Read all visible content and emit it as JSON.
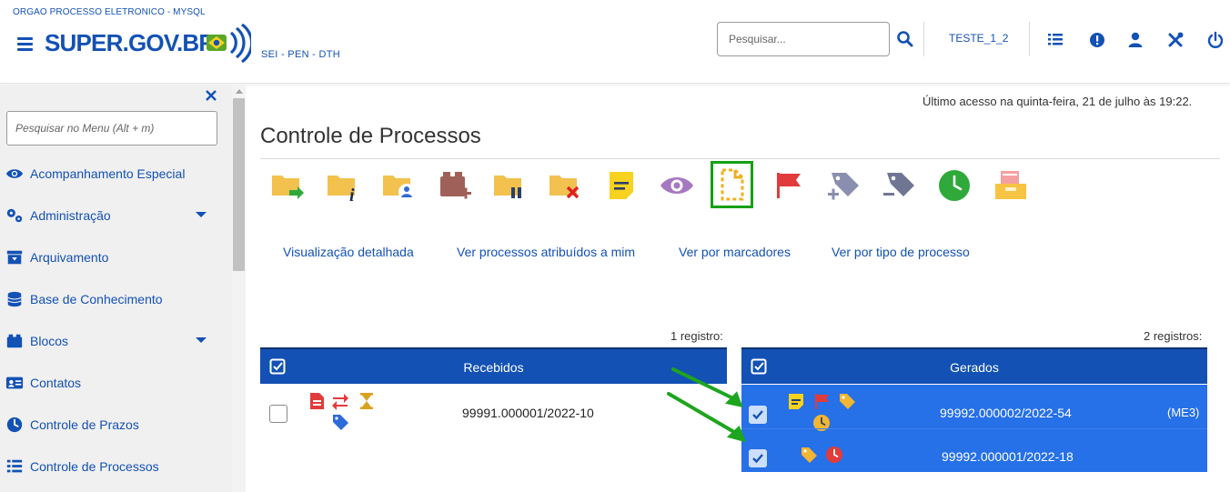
{
  "header": {
    "org": "ORGAO PROCESSO ELETRONICO - MYSQL",
    "logo_text": "SUPER.GOV.BR",
    "subsystem": "SEI - PEN - DTH",
    "search_placeholder": "Pesquisar...",
    "unit": "TESTE_1_2",
    "icons": [
      "menu-lines-icon",
      "alert-icon",
      "user-icon",
      "tools-icon",
      "power-icon"
    ]
  },
  "sidebar": {
    "search_placeholder": "Pesquisar no Menu (Alt + m)",
    "items": [
      {
        "label": "Acompanhamento Especial",
        "icon": "eye-icon",
        "has_submenu": false
      },
      {
        "label": "Administração",
        "icon": "gears-icon",
        "has_submenu": true
      },
      {
        "label": "Arquivamento",
        "icon": "archive-icon",
        "has_submenu": false
      },
      {
        "label": "Base de Conhecimento",
        "icon": "database-icon",
        "has_submenu": false
      },
      {
        "label": "Blocos",
        "icon": "blocks-icon",
        "has_submenu": true
      },
      {
        "label": "Contatos",
        "icon": "contact-card-icon",
        "has_submenu": false
      },
      {
        "label": "Controle de Prazos",
        "icon": "clock-icon",
        "has_submenu": false
      },
      {
        "label": "Controle de Processos",
        "icon": "list-icon",
        "has_submenu": false
      }
    ]
  },
  "main": {
    "last_access": "Último acesso na quinta-feira, 21 de julho às 19:22.",
    "title": "Controle de Processos",
    "toolbar": [
      "send-process-icon",
      "process-info-icon",
      "assign-process-icon",
      "add-to-block-icon",
      "suspend-process-icon",
      "conclude-process-icon",
      "annotation-icon",
      "follow-icon",
      "generate-document-icon",
      "flag-icon",
      "add-marker-icon",
      "remove-marker-icon",
      "deadline-clock-icon",
      "archive-box-icon"
    ],
    "view_links": [
      "Visualização detalhada",
      "Ver processos atribuídos a mim",
      "Ver por marcadores",
      "Ver por tipo de processo"
    ],
    "received": {
      "count": "1 registro:",
      "header": "Recebidos",
      "rows": [
        {
          "process": "99991.000001/2022-10",
          "checked": false
        }
      ]
    },
    "generated": {
      "count": "2 registros:",
      "header": "Gerados",
      "rows": [
        {
          "process": "99992.000002/2022-54",
          "note": "(ME3)",
          "checked": true
        },
        {
          "process": "99992.000001/2022-18",
          "note": "",
          "checked": true
        }
      ]
    }
  },
  "colors": {
    "primary": "#1351b4",
    "selected_row": "#2670e8",
    "folder": "#f2c14e",
    "highlight_border": "#14a114",
    "arrow_annotation": "#1ea51e"
  }
}
